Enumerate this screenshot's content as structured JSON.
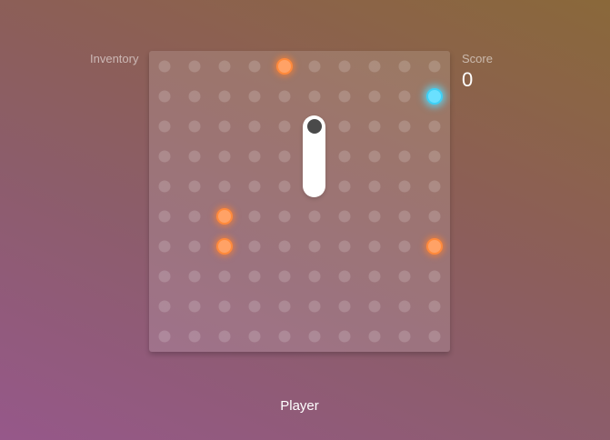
{
  "inventory_label": "Inventory",
  "score": {
    "label": "Score",
    "value": "0"
  },
  "player_label": "Player",
  "board": {
    "columns": 10,
    "rows": 10,
    "orange_orbs": [
      {
        "col": 4,
        "row": 0
      },
      {
        "col": 2,
        "row": 5
      },
      {
        "col": 2,
        "row": 6
      },
      {
        "col": 9,
        "row": 6
      }
    ],
    "cyan_orbs": [
      {
        "col": 9,
        "row": 1
      }
    ],
    "player": {
      "col": 5,
      "row_start": 2,
      "row_end": 4
    }
  },
  "colors": {
    "orange_orb": "#ffa266",
    "cyan_orb": "#6ae0ff",
    "player_body": "#ffffff",
    "player_eye": "#4a4a4a"
  }
}
